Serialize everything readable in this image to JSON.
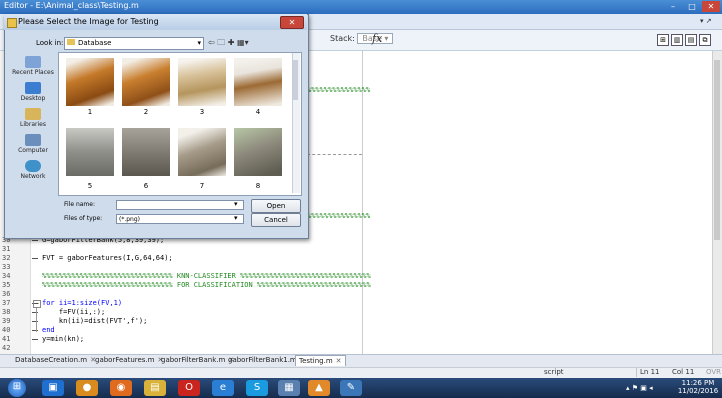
{
  "window": {
    "title": "Editor - E:\\Animal_class\\Testing.m",
    "min_label": "–",
    "max_label": "□",
    "close_label": "✕"
  },
  "toolbar": {
    "stack_label": "Stack:",
    "stack_value": "Base",
    "fx_label": "fx"
  },
  "dialog": {
    "title": "Please Select the Image for Testing",
    "close_label": "✕",
    "look_in_label": "Look in:",
    "look_in_value": "Database",
    "places": [
      "Recent Places",
      "Desktop",
      "Libraries",
      "Computer",
      "Network"
    ],
    "files": [
      "1",
      "2",
      "3",
      "4",
      "5",
      "6",
      "7",
      "8"
    ],
    "file_name_label": "File name:",
    "file_name_value": "",
    "file_type_label": "Files of type:",
    "file_type_value": "(*.png)",
    "open_label": "Open",
    "cancel_label": "Cancel"
  },
  "code": {
    "line_numbers": [
      "30",
      "31",
      "32",
      "33",
      "34",
      "35",
      "36",
      "37",
      "38",
      "39",
      "40",
      "41",
      "42"
    ],
    "lines": [
      "G=gaborFilterBank(5,8,39,39);",
      "",
      "FVT = gaborFeatures(I,G,64,64);",
      "",
      "%%%%%%%%%%%%%%%%%%%%%%%%%%%%%%% KNN-CLASSIFIER %%%%%%%%%%%%%%%%%%%%%%%%%%%%%%%",
      "%%%%%%%%%%%%%%%%%%%%%%%%%%%%%%% FOR CLASSIFICATION %%%%%%%%%%%%%%%%%%%%%%%%%%%",
      "",
      "for ii=1:size(FV,1)",
      "    f=FV(ii,:);",
      "    kn(ii)=dist(FVT',f');",
      "end",
      "y=min(kn);",
      ""
    ],
    "hidden_comment_tail": "%%%%%%%%%%%%%%%"
  },
  "tabs": [
    {
      "label": "DatabaseCreation.m"
    },
    {
      "label": "gaborFeatures.m"
    },
    {
      "label": "gaborFilterBank.m"
    },
    {
      "label": "gaborFilterBank1.m"
    },
    {
      "label": "Testing.m"
    }
  ],
  "status": {
    "mode": "script",
    "ln_label": "Ln",
    "ln": "11",
    "col_label": "Col",
    "col": "11",
    "ovr": "OVR"
  },
  "taskbar": {
    "time": "11:26 PM",
    "date": "11/02/2016"
  }
}
